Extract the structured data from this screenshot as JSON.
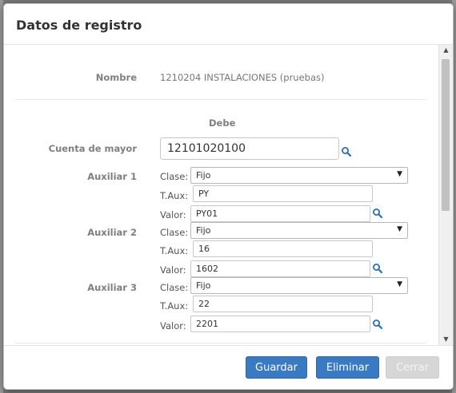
{
  "modal": {
    "title": "Datos de registro"
  },
  "record": {
    "nombre_label": "Nombre",
    "nombre_value": "1210204 INSTALACIONES (pruebas)",
    "section_title": "Debe",
    "cuenta_label": "Cuenta de mayor",
    "cuenta_value": "12101020100"
  },
  "auxiliares": [
    {
      "label": "Auxiliar 1",
      "clase_label": "Clase:",
      "clase_value": "Fijo",
      "taux_label": "T.Aux:",
      "taux_value": "PY",
      "valor_label": "Valor:",
      "valor_value": "PY01"
    },
    {
      "label": "Auxiliar 2",
      "clase_label": "Clase:",
      "clase_value": "Fijo",
      "taux_label": "T.Aux:",
      "taux_value": "16",
      "valor_label": "Valor:",
      "valor_value": "1602"
    },
    {
      "label": "Auxiliar 3",
      "clase_label": "Clase:",
      "clase_value": "Fijo",
      "taux_label": "T.Aux:",
      "taux_value": "22",
      "valor_label": "Valor:",
      "valor_value": "2201"
    }
  ],
  "footer": {
    "guardar_label": "Guardar",
    "eliminar_label": "Eliminar",
    "cerrar_label": "Cerrar"
  },
  "icons": {
    "lookup": "search-icon",
    "dropdown": "caret-down-icon"
  },
  "colors": {
    "primary": "#3a7ac3",
    "disabled": "#d6d6d6",
    "overlay": "#7a7a7a"
  }
}
